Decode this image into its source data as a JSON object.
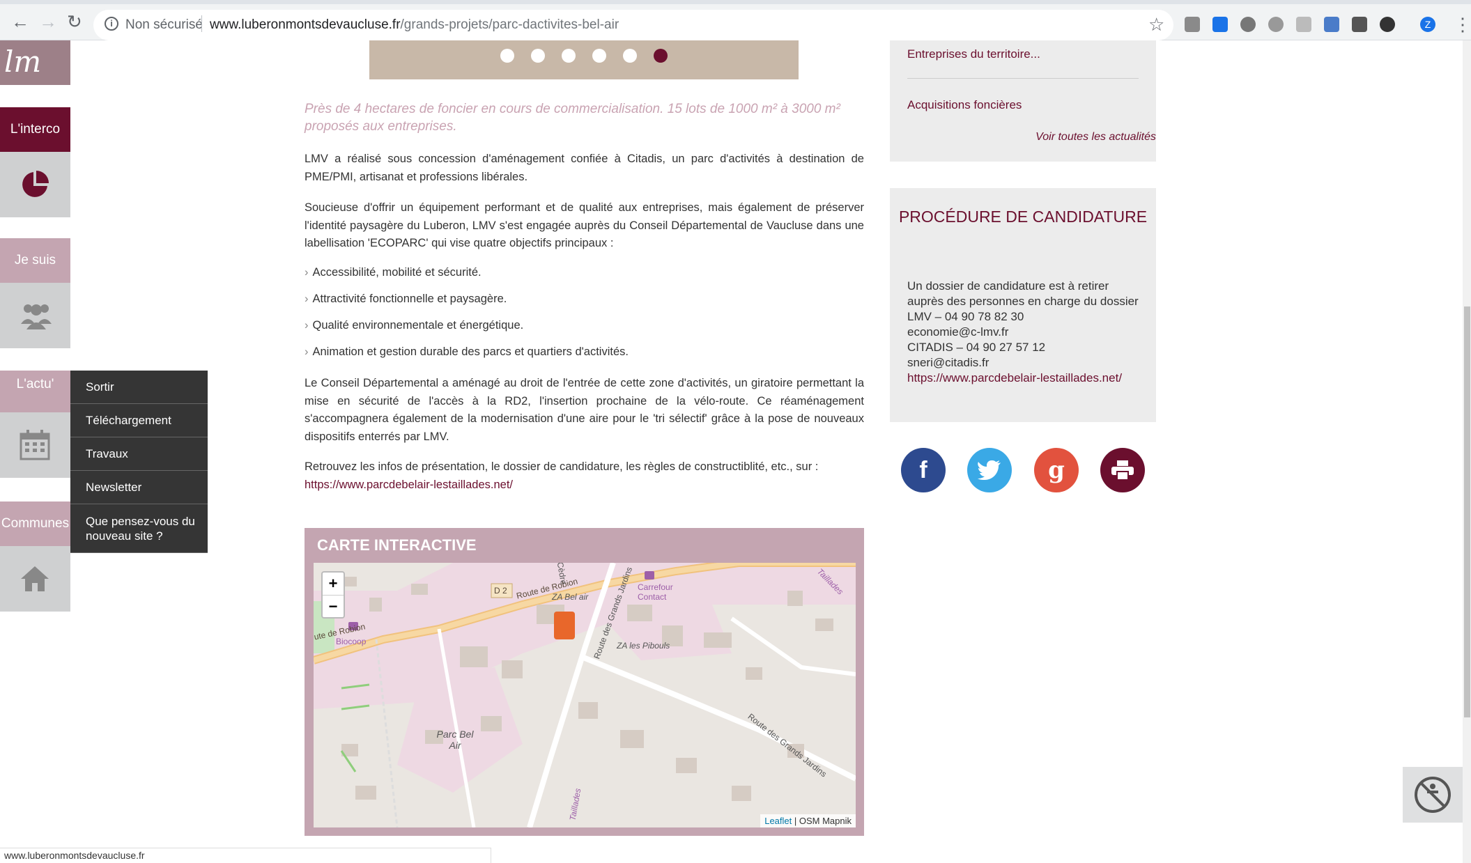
{
  "browser": {
    "back_icon": "←",
    "forward_icon": "→",
    "reload_icon": "↻",
    "security_label": "Non sécurisé",
    "url_host": "www.luberonmontsdevaucluse.fr",
    "url_path": "/grands-projets/parc-dactivites-bel-air",
    "profile_initial": "Z",
    "status_url": "www.luberonmontsdevaucluse.fr"
  },
  "sidebar": {
    "logo_text": "lm",
    "interco_label": "L'interco",
    "jesuis_label": "Je suis",
    "actu_label": "L'actu'",
    "communes_label": "Communes"
  },
  "dropdown": {
    "items": [
      "Sortir",
      "Téléchargement",
      "Travaux",
      "Newsletter",
      "Que pensez-vous du nouveau site ?"
    ]
  },
  "main": {
    "lead": "Près de 4 hectares de foncier en cours de commercialisation. 15 lots de 1000 m² à 3000 m² proposés aux entreprises.",
    "p1": "LMV a réalisé sous concession d'aménagement confiée à Citadis, un parc d'activités à destination de PME/PMI, artisanat et professions libérales.",
    "p2": "Soucieuse d'offrir un équipement performant et de qualité aux entreprises, mais également de préserver l'identité paysagère du Luberon, LMV s'est engagée auprès du Conseil Départemental de Vaucluse dans une labellisation 'ECOPARC' qui vise quatre objectifs principaux :",
    "bullets": [
      "Accessibilité, mobilité et sécurité.",
      "Attractivité fonctionnelle et paysagère.",
      "Qualité environnementale et énergétique.",
      "Animation et gestion durable des parcs et quartiers d'activités."
    ],
    "p3": "Le Conseil Départemental a aménagé au droit de l'entrée de cette zone d'activités, un giratoire permettant la mise en sécurité de l'accès à la RD2, l'insertion prochaine de la vélo-route. Ce réaménagement s'accompagnera également de la modernisation d'une aire pour le 'tri sélectif' grâce à la pose de nouveaux dispositifs enterrés par LMV.",
    "p4": "Retrouvez les infos de présentation, le dossier de candidature, les règles de constructiblité, etc., sur :",
    "p4_link": "https://www.parcdebelair-lestaillades.net/",
    "map_title": "CARTE INTERACTIVE",
    "zoom_in": "+",
    "zoom_out": "−",
    "map_attr_link": "Leaflet",
    "map_attr_text": " | OSM Mapnik",
    "map_labels": {
      "route_robion": "Route de Robion",
      "route_robion_left": "ute de Robion",
      "d2": "D 2",
      "za_bel_air": "ZA Bel air",
      "carrefour": "Carrefour Contact",
      "za_pibouls": "ZA les Pibouls",
      "biocoop": "Biocoop",
      "parc_bel_air": "Parc Bel Air",
      "route_grands_jardins": "Route des Grands Jardins",
      "route_grands_jardins_2": "Route des Grands Jardins",
      "taillades": "Taillades",
      "cedre": "Cèdre",
      "taillades_2": "Taillades"
    }
  },
  "right": {
    "news": [
      "Entreprises du territoire...",
      "Acquisitions foncières"
    ],
    "news_all": "Voir toutes les actualités",
    "proc_title": "PROCÉDURE DE CANDIDATURE",
    "proc_lines": [
      "Un dossier de candidature est à retirer auprès des personnes en charge du dossier",
      "LMV –  04 90 78 82 30",
      "economie@c-lmv.fr",
      "CITADIS – 04 90 27 57 12",
      "sneri@citadis.fr"
    ],
    "proc_link": "https://www.parcdebelair-lestaillades.net/",
    "social": {
      "facebook": "f",
      "google": "g"
    }
  },
  "colors": {
    "brand": "#6b0f2e",
    "rose": "#c4a5b1",
    "dark_menu": "#353535"
  },
  "icons": [
    "info-icon",
    "star-icon",
    "pie-chart-icon",
    "users-icon",
    "calendar-icon",
    "home-icon",
    "facebook-icon",
    "twitter-icon",
    "google-plus-icon",
    "print-icon",
    "accessibility-icon",
    "shop-icon",
    "factory-marker-icon"
  ]
}
